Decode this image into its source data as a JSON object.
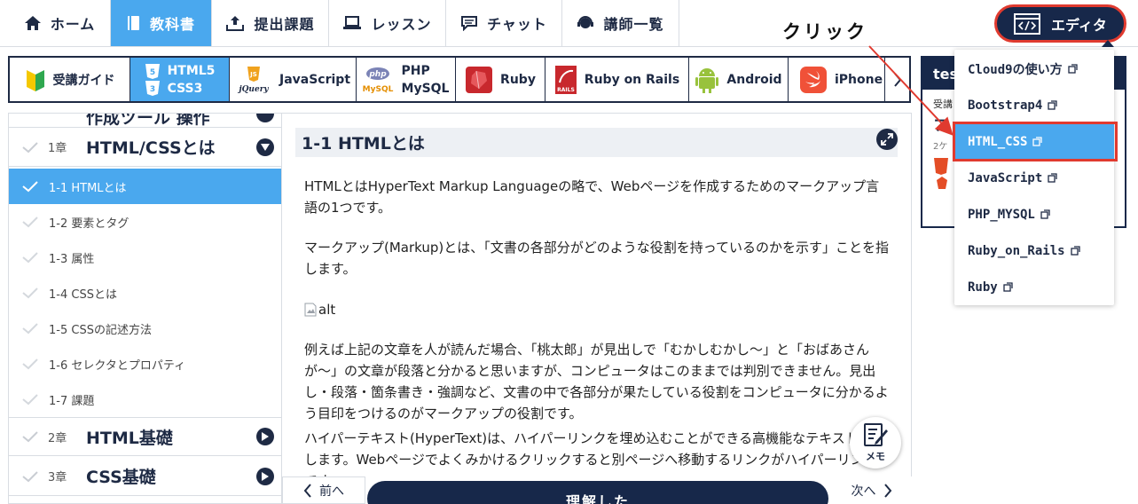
{
  "nav": {
    "items": [
      {
        "label": "ホーム",
        "icon": "home-icon"
      },
      {
        "label": "教科書",
        "icon": "book-icon",
        "active": true
      },
      {
        "label": "提出課題",
        "icon": "upload-tray-icon"
      },
      {
        "label": "レッスン",
        "icon": "laptop-icon"
      },
      {
        "label": "チャット",
        "icon": "chat-icon"
      },
      {
        "label": "講師一覧",
        "icon": "headset-icon"
      }
    ],
    "editor_label": "エディタ",
    "active_color": "#4aa8ee",
    "dark_color": "#17284a"
  },
  "courses": [
    {
      "label": "受講ガイド",
      "icon": "beginner-mark-icon"
    },
    {
      "label_line1": "HTML5",
      "label_line2": "CSS3",
      "icon": "html5-css3-icon",
      "active": true
    },
    {
      "label": "JavaScript",
      "icon": "js-jquery-icon",
      "icon_text_top": "JS",
      "icon_text_bottom": "jQuery"
    },
    {
      "label_line1": "PHP",
      "label_line2": "MySQL",
      "icon": "php-mysql-icon",
      "icon_text_top": "php",
      "icon_text_bottom": "MySQL"
    },
    {
      "label": "Ruby",
      "icon": "ruby-gem-icon"
    },
    {
      "label": "Ruby on Rails",
      "icon": "rails-icon",
      "icon_text": "RAILS"
    },
    {
      "label": "Android",
      "icon": "android-icon"
    },
    {
      "label": "iPhone",
      "icon": "swift-icon"
    }
  ],
  "sidebar": {
    "top_partial": "作成ツール 操作",
    "chapters": [
      {
        "num": "1章",
        "title": "HTML/CSSとは",
        "expanded": true
      },
      {
        "num": "2章",
        "title": "HTML基礎",
        "expanded": false
      },
      {
        "num": "3章",
        "title": "CSS基礎",
        "expanded": false
      }
    ],
    "lessons": [
      {
        "label": "1-1 HTMLとは",
        "active": true
      },
      {
        "label": "1-2 要素とタグ"
      },
      {
        "label": "1-3 属性"
      },
      {
        "label": "1-4 CSSとは"
      },
      {
        "label": "1-5 CSSの記述方法"
      },
      {
        "label": "1-6 セレクタとプロパティ"
      },
      {
        "label": "1-7 課題"
      }
    ]
  },
  "main": {
    "title": "1-1 HTMLとは",
    "p1": "HTMLとはHyperText Markup Languageの略で、Webページを作成するためのマークアップ言語の1つです。",
    "p2": "マークアップ(Markup)とは、「文書の各部分がどのような役割を持っているのかを示す」ことを指します。",
    "img_alt": "alt",
    "p3": "例えば上記の文章を人が読んだ場合、「桃太郎」が見出しで「むかしむかし〜」と「おばあさんが〜」の文章が段落と分かると思いますが、コンピュータはこのままでは判別できません。見出し・段落・箇条書き・強調など、文書の中で各部分が果たしている役割をコンピュータに分かるよう目印をつけるのがマークアップの役割です。",
    "p4": "ハイパーテキスト(HyperText)は、ハイパーリンクを埋め込むことができる高機能なテキストを指します。Webページでよくみかけるクリックすると別ページへ移動するリンクがハイパーリンクです。",
    "memo_label": "メモ",
    "prev_label": "前へ",
    "understood_label": "理解した",
    "next_label": "次へ"
  },
  "right_panel": {
    "head": "tes",
    "sub": "受講",
    "title": "フ",
    "time": "2ケ"
  },
  "dropdown": {
    "items": [
      {
        "label": "Cloud9の使い方"
      },
      {
        "label": "Bootstrap4"
      },
      {
        "label": "HTML_CSS",
        "active": true
      },
      {
        "label": "JavaScript"
      },
      {
        "label": "PHP_MYSQL"
      },
      {
        "label": "Ruby_on_Rails"
      },
      {
        "label": "Ruby"
      }
    ],
    "external_icon": "external-link-icon"
  },
  "annotation": {
    "label": "クリック",
    "color": "#e03a2f"
  }
}
